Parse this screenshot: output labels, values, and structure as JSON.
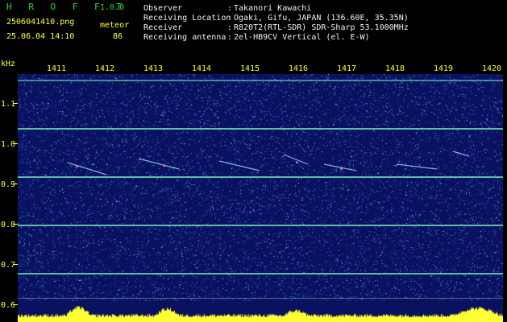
{
  "app": {
    "title": "H R O F F T",
    "version": "1.0.0"
  },
  "file": {
    "name": "2506041410.png",
    "datetime": "25.06.04 14:10"
  },
  "meteor": {
    "label": "meteor",
    "count": "86"
  },
  "info": [
    {
      "key": "Observer",
      "value": "Takanori Kawachi"
    },
    {
      "key": "Receiving Location",
      "value": "Ogaki, Gifu, JAPAN (136.60E, 35.35N)"
    },
    {
      "key": "Receiver",
      "value": "R820T2(RTL-SDR) SDR-Sharp 53.1000MHz"
    },
    {
      "key": "Receiving antenna",
      "value": "2el-HB9CV Vertical (el. E-W)"
    }
  ],
  "axis": {
    "y_unit": "kHz",
    "y_ticks": [
      "1.1",
      "1.0",
      "0.9",
      "0.8",
      "0.7",
      "0.6"
    ],
    "x_ticks": [
      "1411",
      "1412",
      "1413",
      "1414",
      "1415",
      "1416",
      "1417",
      "1418",
      "1419",
      "1420"
    ]
  },
  "colors": {
    "background": "#0a1260",
    "text_label": "#ffff33",
    "text_info": "#f2f2f2",
    "title": "#22dd22"
  }
}
